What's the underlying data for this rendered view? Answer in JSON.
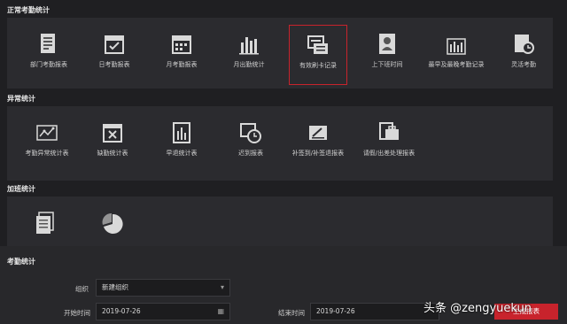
{
  "sections": {
    "normal": {
      "title": "正常考勤统计"
    },
    "abnormal": {
      "title": "异常统计"
    },
    "overtime": {
      "title": "加班统计"
    }
  },
  "normal_tiles": [
    {
      "label": "部门考勤报表",
      "icon": "report-doc-icon"
    },
    {
      "label": "日考勤报表",
      "icon": "calendar-check-icon"
    },
    {
      "label": "月考勤报表",
      "icon": "calendar-grid-icon"
    },
    {
      "label": "月出勤统计",
      "icon": "bar-chart-icon"
    },
    {
      "label": "有效刷卡记录",
      "icon": "card-record-icon"
    },
    {
      "label": "上下班时间",
      "icon": "person-card-icon"
    },
    {
      "label": "最早及最晚考勤记录",
      "icon": "bar-stats-icon"
    },
    {
      "label": "灵活考勤",
      "icon": "clock-doc-icon"
    }
  ],
  "abnormal_tiles": [
    {
      "label": "考勤异常统计表",
      "icon": "abnormal-chart-icon"
    },
    {
      "label": "缺勤统计表",
      "icon": "absence-icon"
    },
    {
      "label": "早退统计表",
      "icon": "early-leave-icon"
    },
    {
      "label": "迟到报表",
      "icon": "late-clock-icon"
    },
    {
      "label": "补签到/补签退报表",
      "icon": "resign-icon"
    },
    {
      "label": "请假/出差处理报表",
      "icon": "leave-trip-icon"
    }
  ],
  "overtime_tiles": [
    {
      "label": "",
      "icon": "overtime-doc-icon"
    },
    {
      "label": "",
      "icon": "pie-chart-icon"
    }
  ],
  "form": {
    "title": "考勤统计",
    "org_label": "组织",
    "org_value": "新建组织",
    "start_label": "开始时间",
    "start_value": "2019-07-26",
    "end_label": "结束时间",
    "end_value": "2019-07-26",
    "generate_button": "生成报表"
  },
  "watermark": "头条 @zengyuekun",
  "colors": {
    "accent": "#c8232c",
    "background": "#1f1f22",
    "panel": "#2b2b2f"
  }
}
